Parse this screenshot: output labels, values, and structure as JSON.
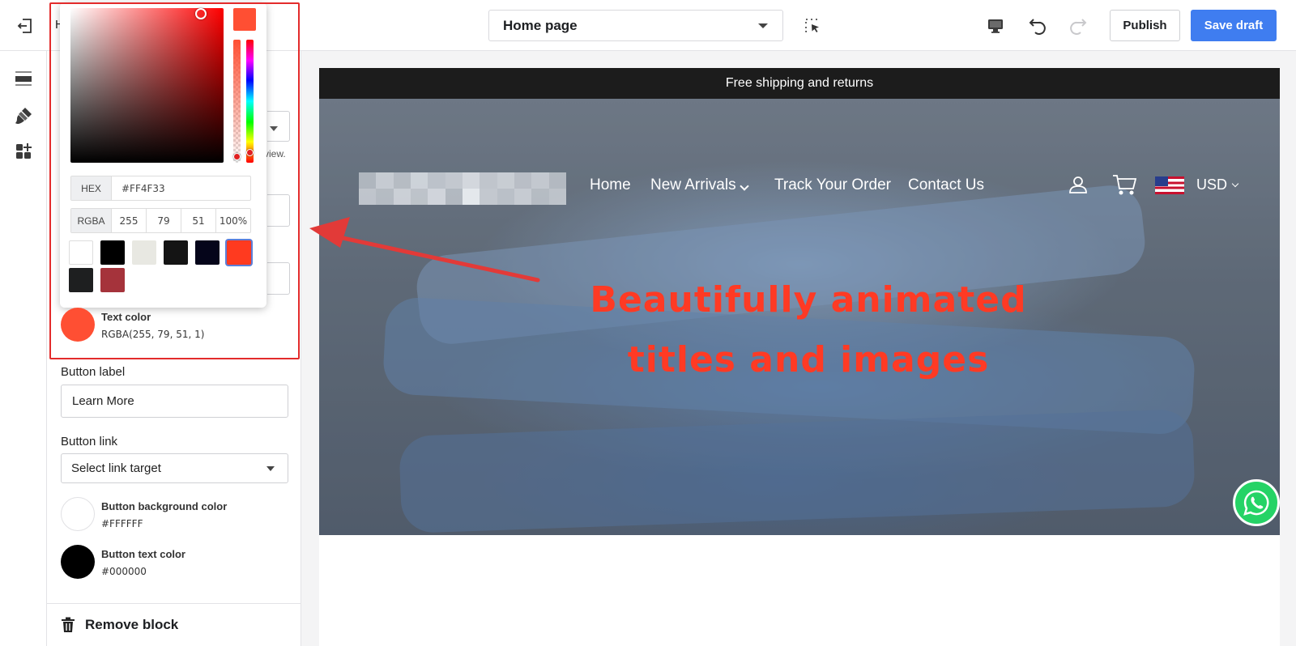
{
  "topbar": {
    "title_fragment": "H",
    "page_select": "Home page",
    "publish_label": "Publish",
    "save_label": "Save draft"
  },
  "panel": {
    "fragment_text": "view.",
    "picker": {
      "hex_label": "HEX",
      "hex_value": "#FF4F33",
      "rgba_label": "RGBA",
      "r": "255",
      "g": "79",
      "b": "51",
      "a": "100%",
      "swatches": [
        "#FFFFFF",
        "#000000",
        "#E8E8E2",
        "#141414",
        "#05051A",
        "#FF3A1F",
        "#1E1F20",
        "#A5333B"
      ]
    },
    "text_color": {
      "label": "Text color",
      "value": "RGBA(255, 79, 51, 1)",
      "color": "#FF4F33"
    },
    "button_label": {
      "label": "Button label",
      "value": "Learn More"
    },
    "button_link": {
      "label": "Button link",
      "value": "Select link target"
    },
    "button_bg_color": {
      "label": "Button background color",
      "value": "#FFFFFF"
    },
    "button_text_color": {
      "label": "Button text color",
      "value": "#000000"
    },
    "remove_block": "Remove block"
  },
  "preview": {
    "announcement": "Free shipping and returns",
    "nav": [
      "Home",
      "New Arrivals",
      "Track Your Order",
      "Contact Us"
    ],
    "currency": "USD",
    "headline_line1": "Beautifully animated",
    "headline_line2": "titles and images"
  },
  "colors": {
    "accent": "#3F7DF0",
    "annotation_red": "#E32B2B",
    "headline_red": "#FF3A24",
    "announce_bg": "#1C1C1C",
    "whatsapp": "#25D366"
  },
  "icons": {
    "exit": "exit-icon",
    "select_element": "cursor-select-icon",
    "desktop": "desktop-icon",
    "undo": "undo-icon",
    "redo": "redo-icon",
    "sections": "sections-icon",
    "theme": "paint-brush-icon",
    "apps": "apps-add-icon",
    "trash": "trash-icon",
    "account": "user-icon",
    "cart": "cart-icon",
    "whatsapp": "whatsapp-icon"
  }
}
